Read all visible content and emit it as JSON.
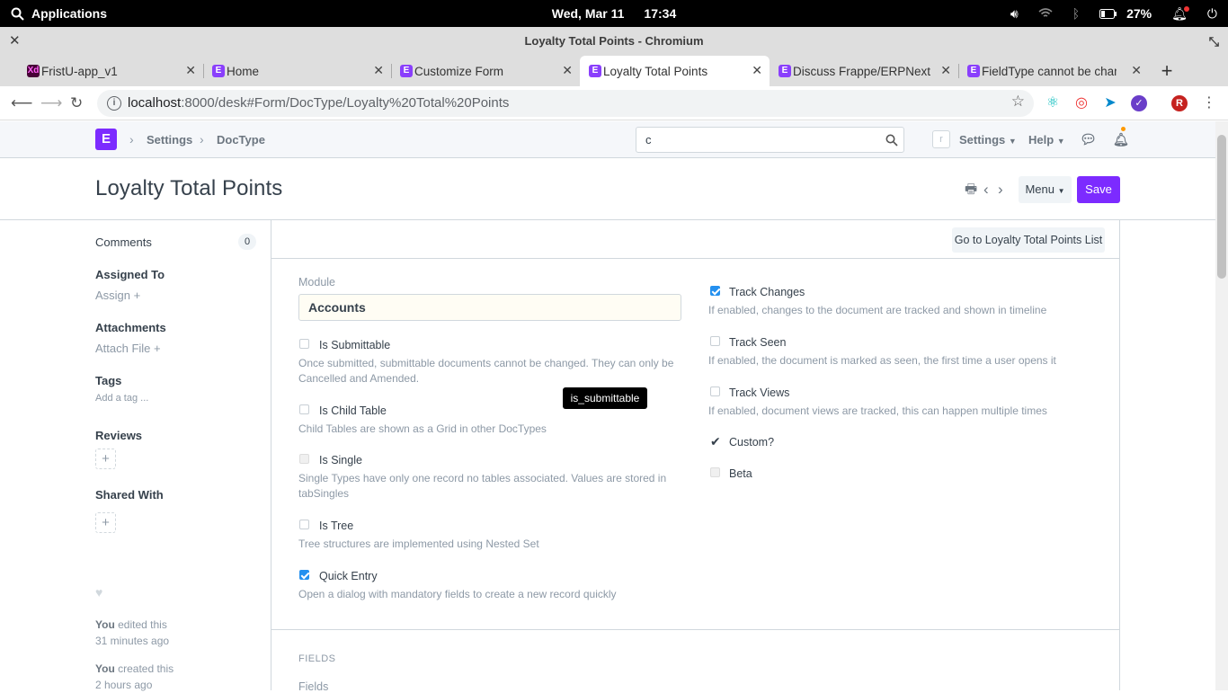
{
  "os": {
    "apps_label": "Applications",
    "date": "Wed, Mar 11",
    "time": "17:34",
    "battery": "27%"
  },
  "window": {
    "title": "Loyalty Total Points - Chromium"
  },
  "tabs": [
    {
      "label": "FristU-app_v1",
      "icon": "xd-icon"
    },
    {
      "label": "Home",
      "icon": "erpnext-icon"
    },
    {
      "label": "Customize Form",
      "icon": "erpnext-icon"
    },
    {
      "label": "Loyalty Total Points",
      "icon": "erpnext-icon",
      "active": true
    },
    {
      "label": "Discuss Frappe/ERPNext",
      "icon": "erpnext-icon"
    },
    {
      "label": "FieldType cannot be chang",
      "icon": "erpnext-icon"
    }
  ],
  "address": {
    "host": "localhost",
    "path": ":8000/desk#Form/DocType/Loyalty%20Total%20Points"
  },
  "navbar": {
    "logo": "E",
    "breadcrumbs": [
      "Settings",
      "DocType"
    ],
    "search_value": "c",
    "avatar_letter": "r",
    "settings_label": "Settings",
    "help_label": "Help"
  },
  "page": {
    "title": "Loyalty Total Points",
    "menu_label": "Menu",
    "save_label": "Save",
    "goto_list_label": "Go to Loyalty Total Points List"
  },
  "sidebar": {
    "comments_label": "Comments",
    "comments_count": "0",
    "assigned_to": "Assigned To",
    "assign": "Assign",
    "attachments": "Attachments",
    "attach_file": "Attach File",
    "tags": "Tags",
    "add_tag": "Add a tag ...",
    "reviews": "Reviews",
    "shared_with": "Shared With",
    "activity": [
      {
        "who": "You",
        "what": " edited this",
        "when": "31 minutes ago"
      },
      {
        "who": "You",
        "what": " created this",
        "when": "2 hours ago"
      }
    ]
  },
  "form": {
    "module_label": "Module",
    "module_value": "Accounts",
    "left_fields": [
      {
        "label": "Is Submittable",
        "checked": false,
        "desc": "Once submitted, submittable documents cannot be changed. They can only be Cancelled and Amended."
      },
      {
        "label": "Is Child Table",
        "checked": false,
        "desc": "Child Tables are shown as a Grid in other DocTypes"
      },
      {
        "label": "Is Single",
        "checked": false,
        "disabled": true,
        "desc": "Single Types have only one record no tables associated. Values are stored in tabSingles"
      },
      {
        "label": "Is Tree",
        "checked": false,
        "desc": "Tree structures are implemented using Nested Set"
      },
      {
        "label": "Quick Entry",
        "checked": true,
        "desc": "Open a dialog with mandatory fields to create a new record quickly"
      }
    ],
    "right_fields": [
      {
        "label": "Track Changes",
        "checked": true,
        "desc": "If enabled, changes to the document are tracked and shown in timeline"
      },
      {
        "label": "Track Seen",
        "checked": false,
        "desc": "If enabled, the document is marked as seen, the first time a user opens it"
      },
      {
        "label": "Track Views",
        "checked": false,
        "desc": "If enabled, document views are tracked, this can happen multiple times"
      },
      {
        "label": "Custom?",
        "checked": true,
        "readonly": true
      },
      {
        "label": "Beta",
        "checked": false,
        "disabled": true
      }
    ],
    "tooltip": "is_submittable",
    "section_fields": "FIELDS",
    "fields_label": "Fields"
  },
  "colors": {
    "brand": "#7c2bff",
    "checkbox_on": "#2490ef"
  }
}
